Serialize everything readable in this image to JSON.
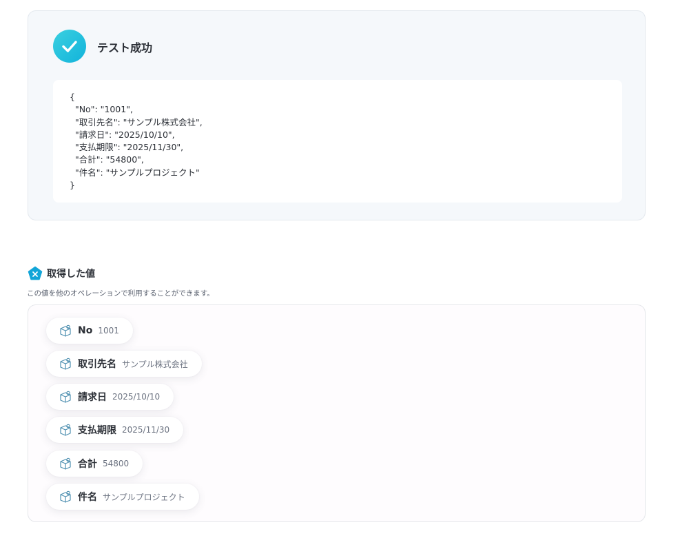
{
  "test_result": {
    "title": "テスト成功",
    "json_lines": [
      "{",
      "  \"No\": \"1001\",",
      "  \"取引先名\": \"サンプル株式会社\",",
      "  \"請求日\": \"2025/10/10\",",
      "  \"支払期限\": \"2025/11/30\",",
      "  \"合計\": \"54800\",",
      "  \"件名\": \"サンプルプロジェクト\"",
      "}"
    ]
  },
  "retrieved": {
    "title": "取得した値",
    "description": "この値を他のオペレーションで利用することができます。",
    "items": [
      {
        "key": "No",
        "value": "1001"
      },
      {
        "key": "取引先名",
        "value": "サンプル株式会社"
      },
      {
        "key": "請求日",
        "value": "2025/10/10"
      },
      {
        "key": "支払期限",
        "value": "2025/11/30"
      },
      {
        "key": "合計",
        "value": "54800"
      },
      {
        "key": "件名",
        "value": "サンプルプロジェクト"
      }
    ]
  },
  "colors": {
    "accent": "#12b3db",
    "card_bg": "#f5f8fb"
  }
}
